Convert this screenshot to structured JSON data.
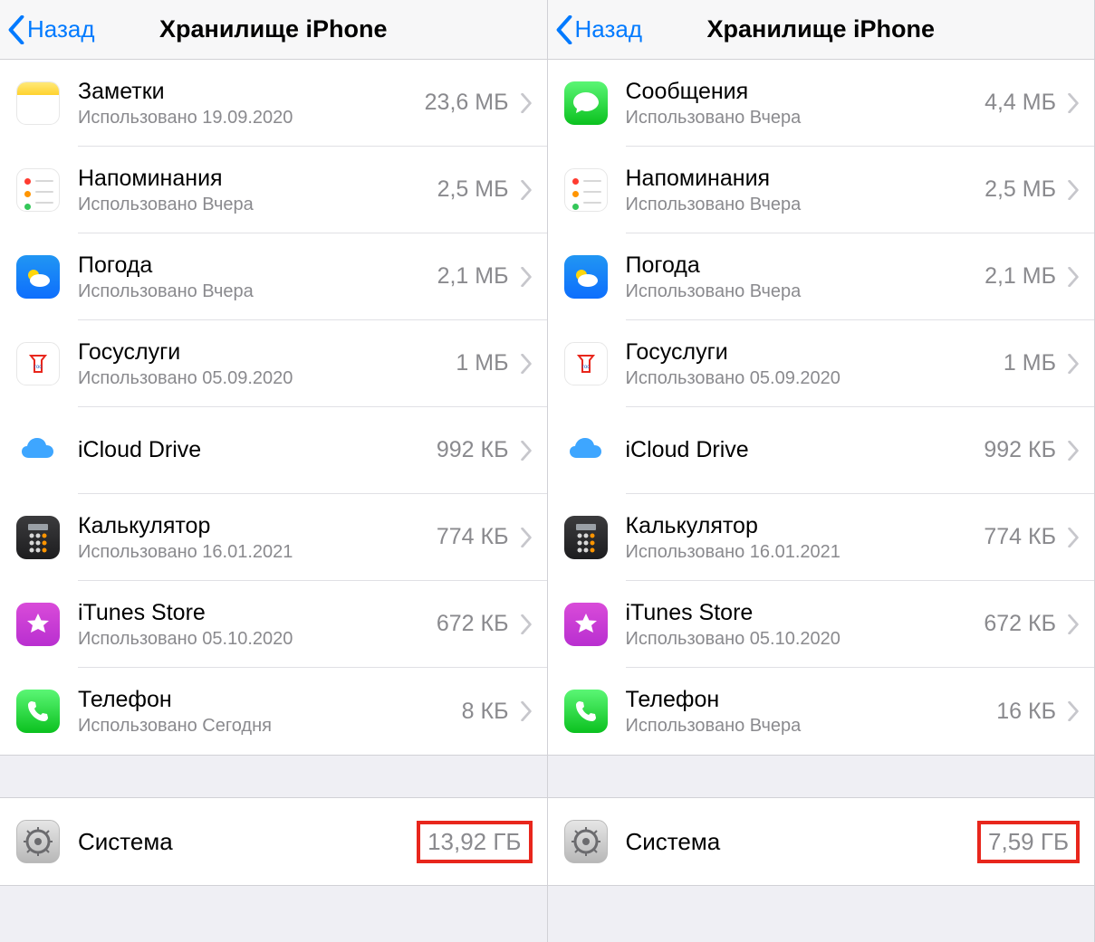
{
  "panes": [
    {
      "back_label": "Назад",
      "title": "Хранилище iPhone",
      "apps": [
        {
          "icon": "notes",
          "name": "Заметки",
          "sub": "Использовано 19.09.2020",
          "size": "23,6 МБ"
        },
        {
          "icon": "reminders",
          "name": "Напоминания",
          "sub": "Использовано Вчера",
          "size": "2,5 МБ"
        },
        {
          "icon": "weather",
          "name": "Погода",
          "sub": "Использовано Вчера",
          "size": "2,1 МБ"
        },
        {
          "icon": "gosuslugi",
          "name": "Госуслуги",
          "sub": "Использовано 05.09.2020",
          "size": "1 МБ"
        },
        {
          "icon": "icloud",
          "name": "iCloud Drive",
          "sub": "",
          "size": "992 КБ"
        },
        {
          "icon": "calc",
          "name": "Калькулятор",
          "sub": "Использовано 16.01.2021",
          "size": "774 КБ"
        },
        {
          "icon": "itunes",
          "name": "iTunes Store",
          "sub": "Использовано 05.10.2020",
          "size": "672 КБ"
        },
        {
          "icon": "phone",
          "name": "Телефон",
          "sub": "Использовано Сегодня",
          "size": "8 КБ"
        }
      ],
      "system": {
        "label": "Система",
        "size": "13,92 ГБ"
      }
    },
    {
      "back_label": "Назад",
      "title": "Хранилище iPhone",
      "apps": [
        {
          "icon": "messages",
          "name": "Сообщения",
          "sub": "Использовано Вчера",
          "size": "4,4 МБ"
        },
        {
          "icon": "reminders",
          "name": "Напоминания",
          "sub": "Использовано Вчера",
          "size": "2,5 МБ"
        },
        {
          "icon": "weather",
          "name": "Погода",
          "sub": "Использовано Вчера",
          "size": "2,1 МБ"
        },
        {
          "icon": "gosuslugi",
          "name": "Госуслуги",
          "sub": "Использовано 05.09.2020",
          "size": "1 МБ"
        },
        {
          "icon": "icloud",
          "name": "iCloud Drive",
          "sub": "",
          "size": "992 КБ"
        },
        {
          "icon": "calc",
          "name": "Калькулятор",
          "sub": "Использовано 16.01.2021",
          "size": "774 КБ"
        },
        {
          "icon": "itunes",
          "name": "iTunes Store",
          "sub": "Использовано 05.10.2020",
          "size": "672 КБ"
        },
        {
          "icon": "phone",
          "name": "Телефон",
          "sub": "Использовано Вчера",
          "size": "16 КБ"
        }
      ],
      "system": {
        "label": "Система",
        "size": "7,59 ГБ"
      }
    }
  ]
}
